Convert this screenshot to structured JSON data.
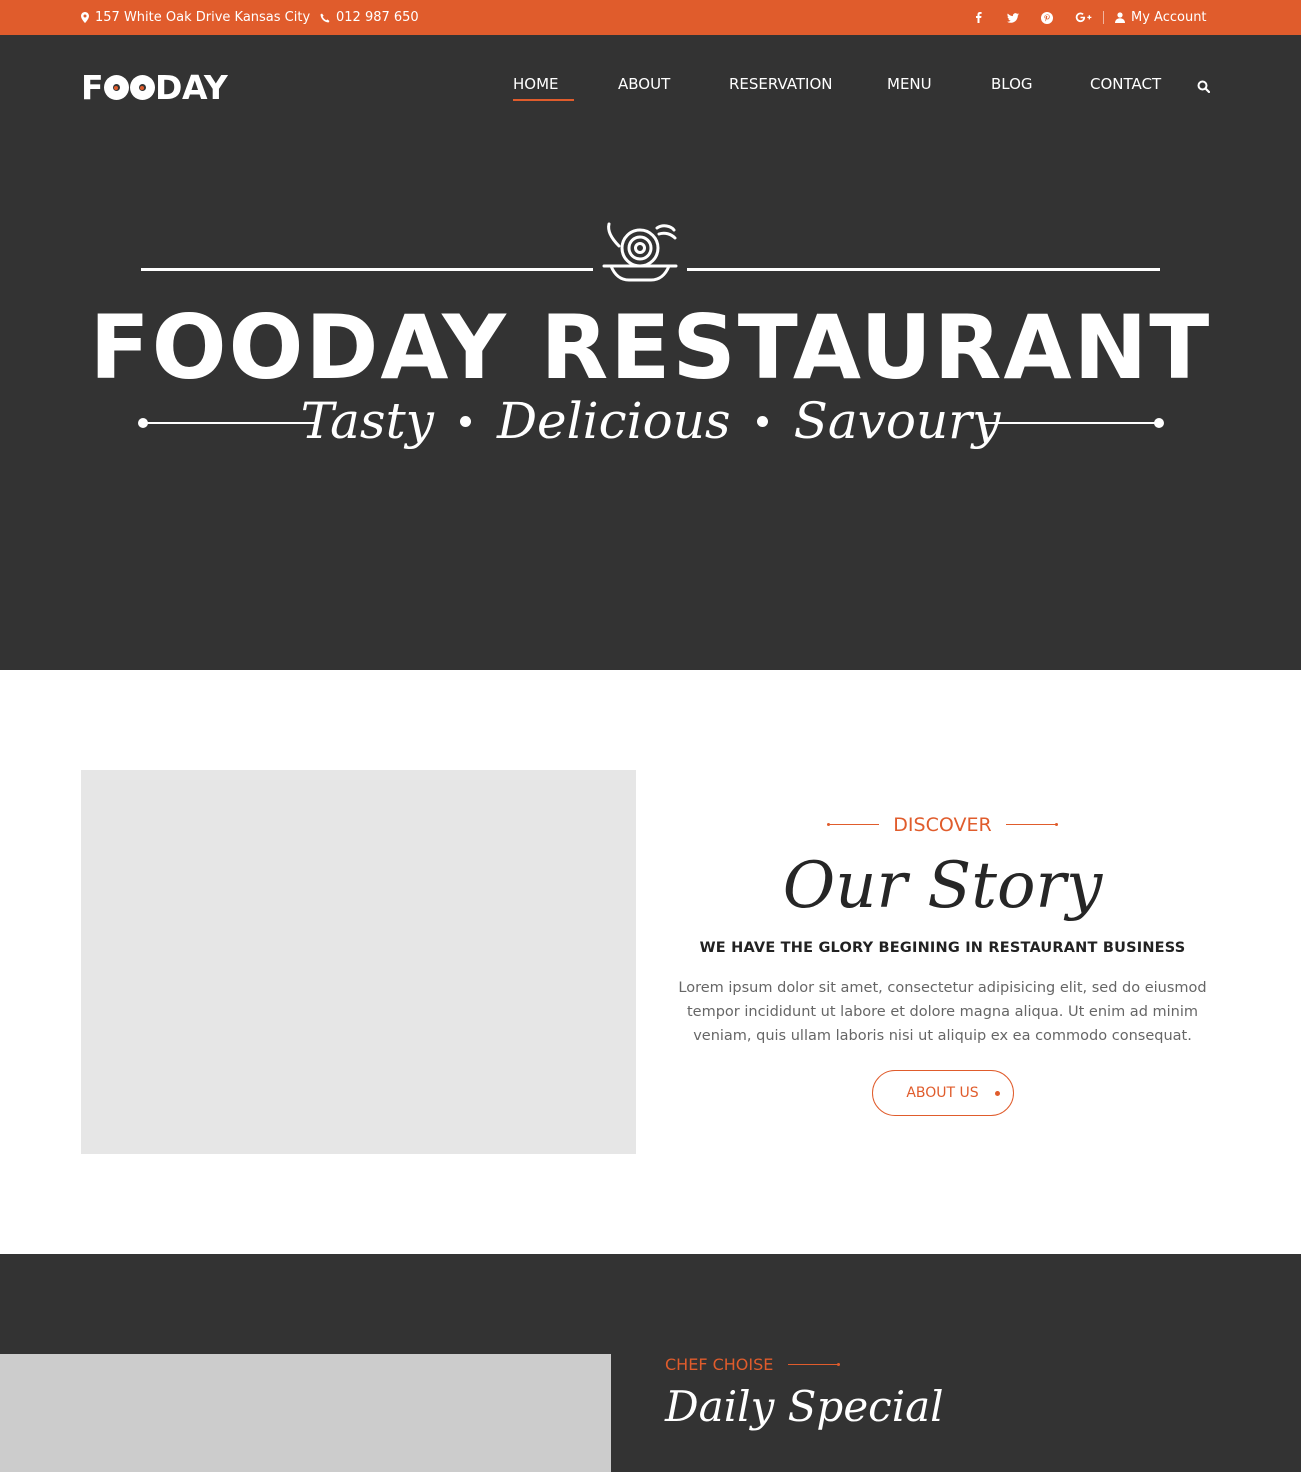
{
  "topbar": {
    "address": "157 White Oak Drive Kansas City",
    "phone": "012 987 650",
    "account": "My Account",
    "social_icons": [
      "facebook-icon",
      "twitter-icon",
      "pinterest-icon",
      "google-plus-icon"
    ],
    "background": "#e05c2c"
  },
  "header": {
    "logo": "FOODAY",
    "nav": [
      "HOME",
      "ABOUT",
      "RESERVATION",
      "MENU",
      "BLOG",
      "CONTACT"
    ],
    "active_nav": "HOME"
  },
  "hero": {
    "icon": "dish-icon",
    "title": "FOODAY RESTAURANT",
    "tagline": [
      "Tasty",
      "Delicious",
      "Savoury"
    ]
  },
  "story": {
    "eyebrow": "DISCOVER",
    "title": "Our Story",
    "subtitle": "WE HAVE THE GLORY BEGINING IN RESTAURANT BUSINESS",
    "body": "Lorem ipsum dolor sit amet, consectetur adipisicing elit, sed do eiusmod tempor incididunt ut labore et dolore magna aliqua. Ut enim ad minim veniam, quis ullam laboris nisi ut aliquip ex ea commodo consequat.",
    "button": "ABOUT US"
  },
  "special": {
    "eyebrow": "CHEF CHOISE",
    "title": "Daily Special"
  },
  "colors": {
    "accent": "#e05c2c",
    "dark": "#333333",
    "image_placeholder": "#e6e6e6"
  }
}
